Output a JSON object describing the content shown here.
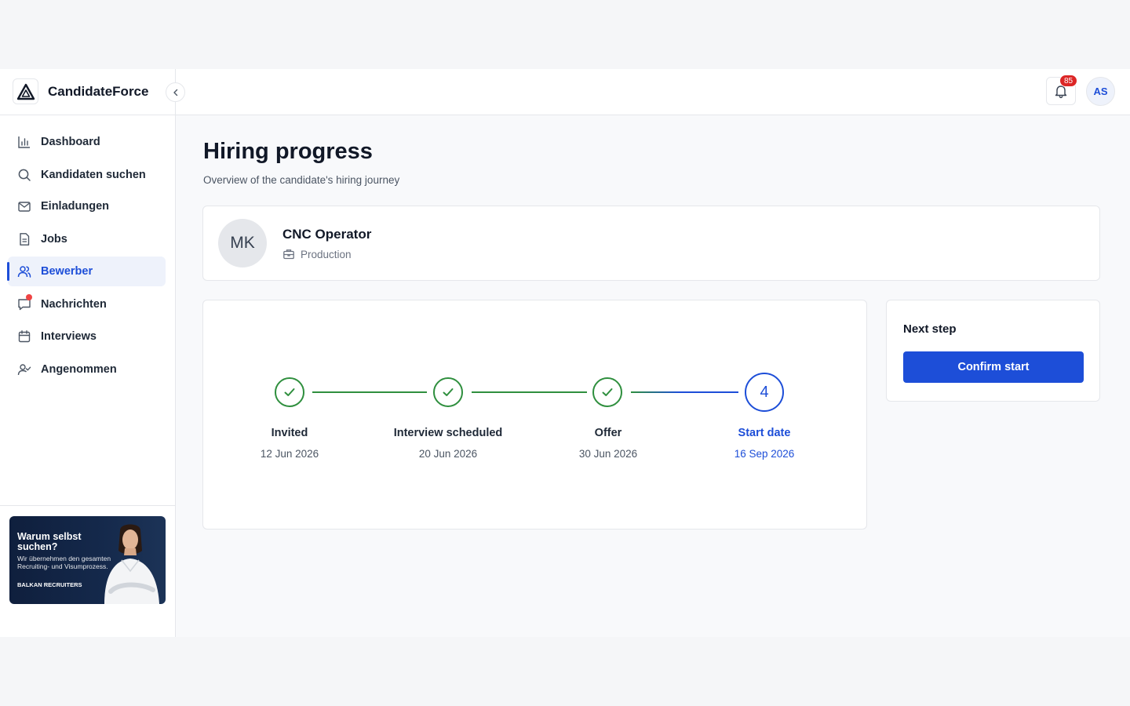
{
  "brand": {
    "name": "CandidateForce"
  },
  "sidebar": {
    "items": [
      {
        "label": "Dashboard",
        "icon": "bar-chart-icon"
      },
      {
        "label": "Kandidaten suchen",
        "icon": "search-icon"
      },
      {
        "label": "Einladungen",
        "icon": "mail-icon"
      },
      {
        "label": "Jobs",
        "icon": "document-icon"
      },
      {
        "label": "Bewerber",
        "icon": "users-icon",
        "active": true
      },
      {
        "label": "Nachrichten",
        "icon": "chat-icon",
        "notification_dot": true
      },
      {
        "label": "Interviews",
        "icon": "calendar-icon"
      },
      {
        "label": "Angenommen",
        "icon": "user-check-icon"
      }
    ],
    "promo": {
      "title": "Warum selbst suchen?",
      "text": "Wir übernehmen den gesamten Recruiting- und Visumprozess.",
      "brand": "BALKAN RECRUITERS"
    }
  },
  "header": {
    "notifications_count": "85",
    "user_initials": "AS"
  },
  "main": {
    "title": "Hiring progress",
    "subtitle": "Overview of the candidate's hiring journey",
    "candidate": {
      "initials": "MK",
      "job_title": "CNC Operator",
      "department": "Production"
    },
    "steps": [
      {
        "label": "Invited",
        "date": "12 Jun 2026",
        "status": "done"
      },
      {
        "label": "Interview scheduled",
        "date": "20 Jun 2026",
        "status": "done"
      },
      {
        "label": "Offer",
        "date": "30 Jun 2026",
        "status": "done"
      },
      {
        "label": "Start date",
        "date": "16 Sep 2026",
        "status": "current",
        "number": "4"
      }
    ],
    "next_step": {
      "title": "Next step",
      "button_label": "Confirm start"
    }
  },
  "colors": {
    "accent": "#1d4ed8",
    "success": "#2f8f3e",
    "badge": "#dc2626"
  }
}
